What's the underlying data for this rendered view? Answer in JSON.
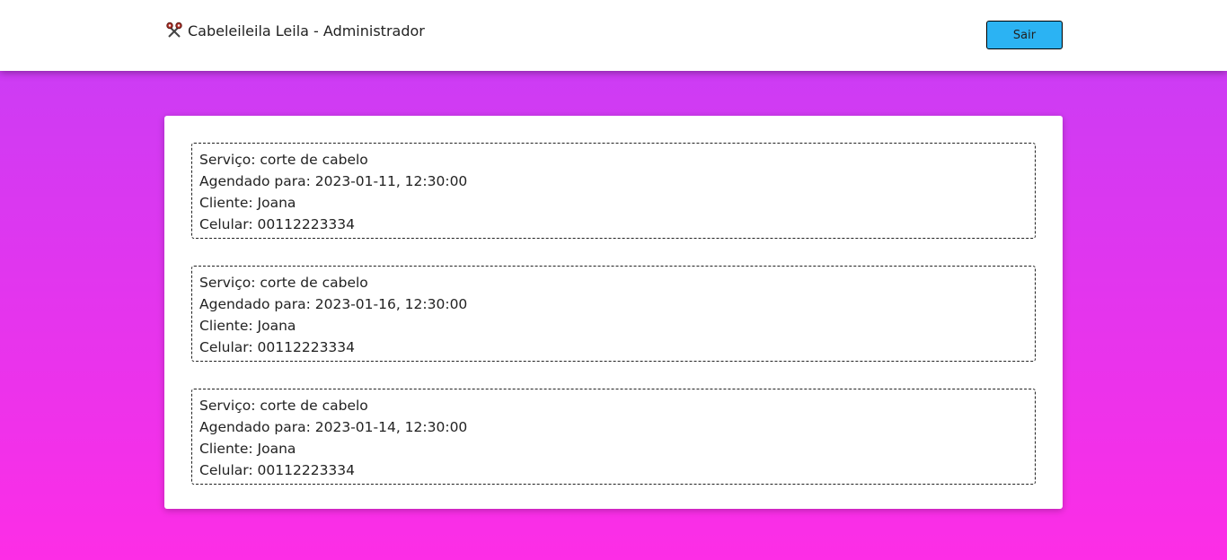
{
  "header": {
    "title": "Cabeleileila Leila - Administrador",
    "logout_label": "Sair",
    "icon": "scissors-icon"
  },
  "appointments": [
    {
      "service": "Serviço: corte de cabelo",
      "scheduled": "Agendado para: 2023-01-11, 12:30:00",
      "client": "Cliente: Joana",
      "phone": "Celular: 00112223334"
    },
    {
      "service": "Serviço: corte de cabelo",
      "scheduled": "Agendado para: 2023-01-16, 12:30:00",
      "client": "Cliente: Joana",
      "phone": "Celular: 00112223334"
    },
    {
      "service": "Serviço: corte de cabelo",
      "scheduled": "Agendado para: 2023-01-14, 12:30:00",
      "client": "Cliente: Joana",
      "phone": "Celular: 00112223334"
    }
  ],
  "colors": {
    "gradient_top": "#c63ef6",
    "gradient_bottom": "#fd2de6",
    "button": "#2bb3f3"
  }
}
